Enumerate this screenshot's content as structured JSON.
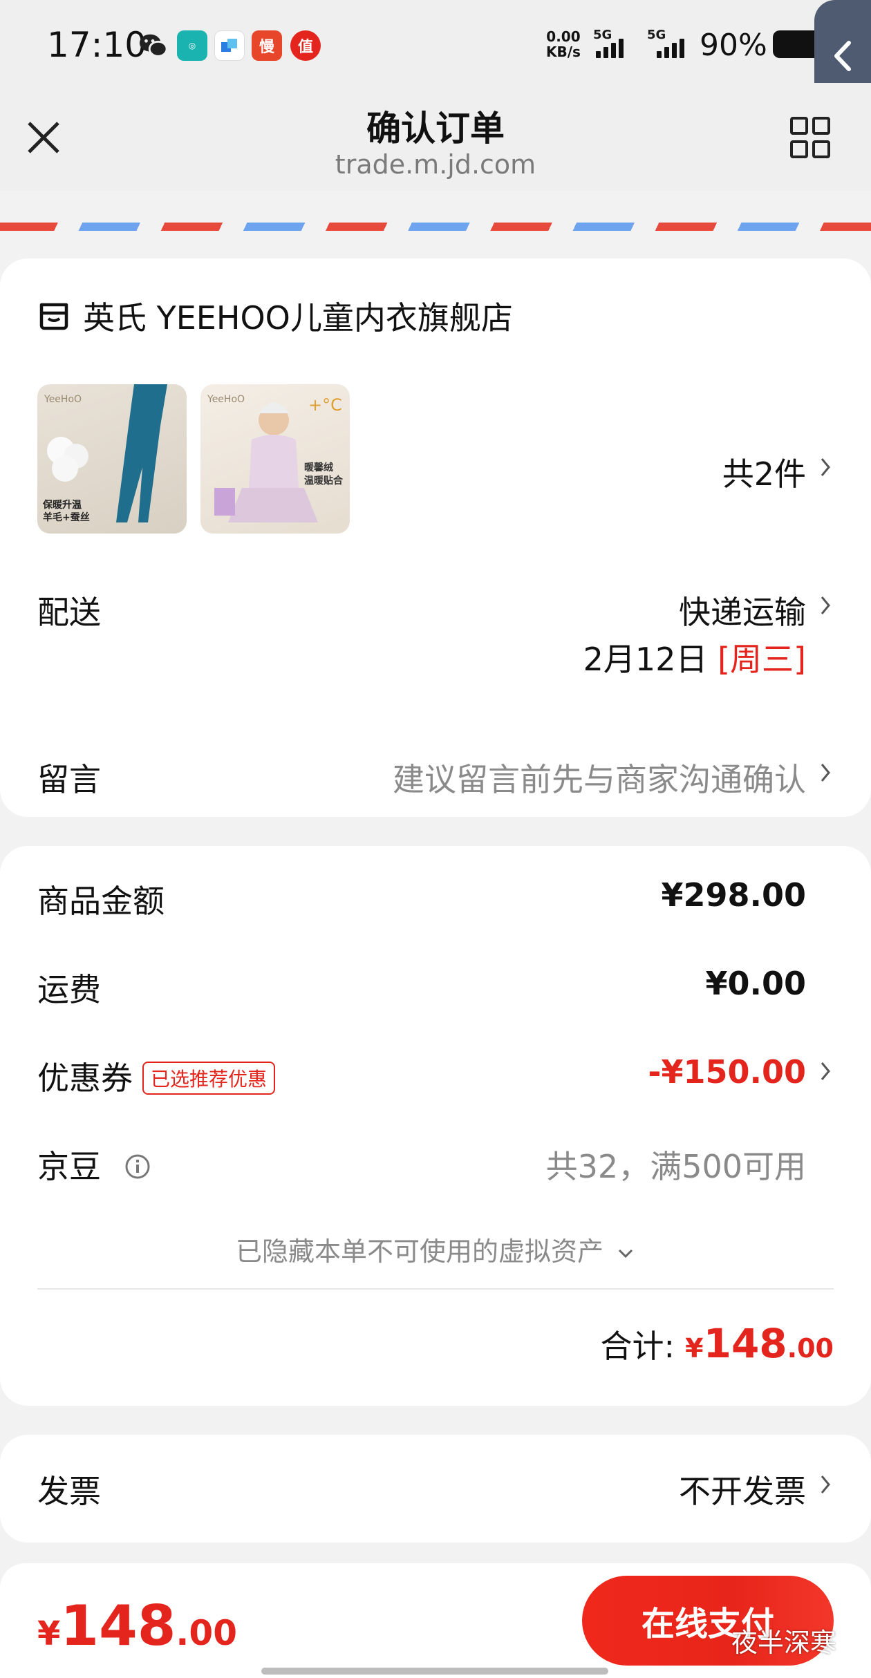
{
  "status_bar": {
    "time": "17:10",
    "net_speed_value": "0.00",
    "net_speed_unit": "KB/s",
    "signal1_label": "5G",
    "signal2_label": "5G",
    "battery": "90%"
  },
  "nav": {
    "title": "确认订单",
    "url": "trade.m.jd.com"
  },
  "store": {
    "name": "英氏 YEEHOO儿童内衣旗舰店",
    "products": [
      {
        "brand": "YeeHoO",
        "caption_line1": "保暖升温",
        "caption_line2": "羊毛+蚕丝"
      },
      {
        "brand": "YeeHoO",
        "temp": "+°C",
        "caption_line1": "暖馨绒",
        "caption_line2": "温暖贴合"
      }
    ],
    "item_count": "共2件"
  },
  "delivery": {
    "label": "配送",
    "method": "快递运输",
    "date": "2月12日",
    "weekday": "[周三]"
  },
  "message": {
    "label": "留言",
    "placeholder": "建议留言前先与商家沟通确认"
  },
  "price": {
    "goods_label": "商品金额",
    "goods_value": "¥298.00",
    "shipping_label": "运费",
    "shipping_value": "¥0.00",
    "coupon_label": "优惠券",
    "coupon_tag": "已选推荐优惠",
    "coupon_value": "-¥150.00",
    "jingdou_label": "京豆",
    "jingdou_value": "共32，满500可用",
    "hidden_assets": "已隐藏本单不可使用的虚拟资产",
    "total_label": "合计:",
    "total_currency": "¥",
    "total_int": "148",
    "total_dec": ".00"
  },
  "invoice": {
    "label": "发票",
    "value": "不开发票"
  },
  "bottom": {
    "currency": "¥",
    "amount_int": "148",
    "amount_dec": ".00",
    "pay_label": "在线支付",
    "watermark": "夜半深寒"
  },
  "colors": {
    "accent_red": "#e4251d",
    "stripe_red": "#e8493d",
    "stripe_blue": "#6ea4ef",
    "back_tab": "#4f5b71"
  }
}
